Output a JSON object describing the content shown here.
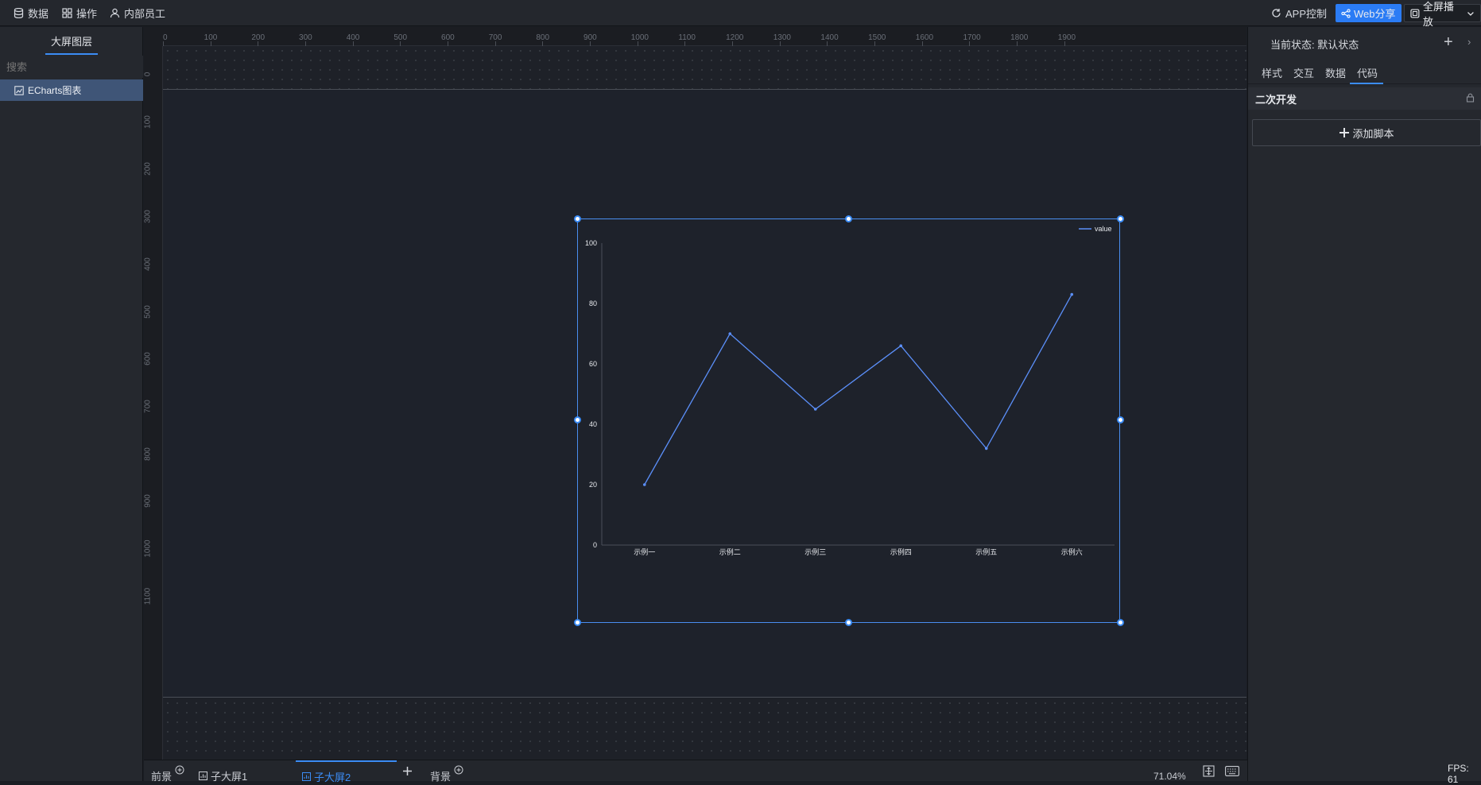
{
  "topbar": {
    "data_label": "数据",
    "ops_label": "操作",
    "staff_label": "内部员工",
    "app_control": "APP控制",
    "web_share": "Web分享",
    "fullscreen": "全屏播放"
  },
  "left_panel": {
    "tab_label": "大屏图层",
    "search_placeholder": "搜索",
    "layers": [
      {
        "label": "ECharts图表"
      }
    ]
  },
  "ruler": {
    "h_ticks": [
      "0",
      "100",
      "200",
      "300",
      "400",
      "500",
      "600",
      "700",
      "800",
      "900",
      "1000",
      "1100",
      "1200",
      "1300",
      "1400",
      "1500",
      "1600",
      "1700",
      "1800",
      "1900"
    ],
    "v_ticks": [
      "0",
      "100",
      "200",
      "300",
      "400",
      "500",
      "600",
      "700",
      "800",
      "900",
      "1000",
      "1100"
    ]
  },
  "right_panel": {
    "state_label": "当前状态:",
    "state_value": "默认状态",
    "tabs": [
      "样式",
      "交互",
      "数据",
      "代码"
    ],
    "active_tab": "代码",
    "section_title": "二次开发",
    "add_script_label": "添加脚本"
  },
  "bottom_bar": {
    "foreground": "前景",
    "sub_screen_1": "子大屏1",
    "sub_screen_2": "子大屏2",
    "background": "背景",
    "zoom": "71.04%"
  },
  "fps_label": "FPS: 61",
  "colors": {
    "accent": "#3b8cf5",
    "series": "#5b8ff9"
  },
  "chart_data": {
    "type": "line",
    "categories": [
      "示例一",
      "示例二",
      "示例三",
      "示例四",
      "示例五",
      "示例六"
    ],
    "series": [
      {
        "name": "value",
        "values": [
          20,
          70,
          45,
          66,
          32,
          83
        ]
      }
    ],
    "ylim": [
      0,
      100
    ],
    "yticks": [
      0,
      20,
      40,
      60,
      80,
      100
    ],
    "legend": "top-right",
    "grid": false
  }
}
